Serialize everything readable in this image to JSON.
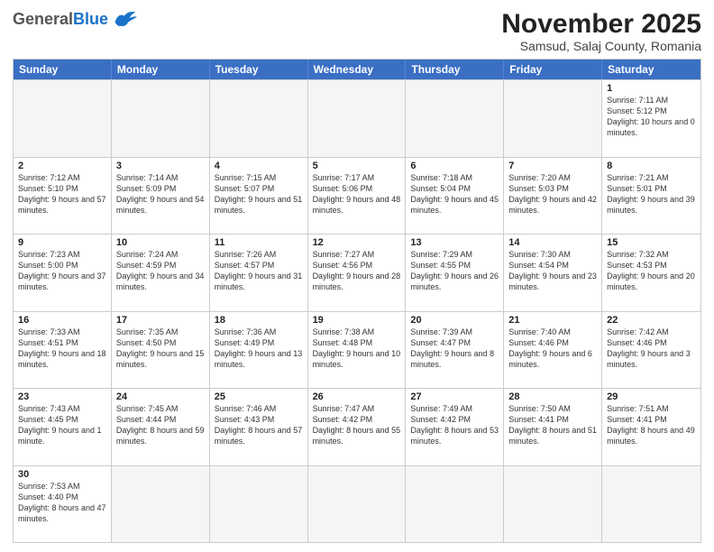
{
  "header": {
    "logo_general": "General",
    "logo_blue": "Blue",
    "month_title": "November 2025",
    "location": "Samsud, Salaj County, Romania"
  },
  "weekdays": [
    "Sunday",
    "Monday",
    "Tuesday",
    "Wednesday",
    "Thursday",
    "Friday",
    "Saturday"
  ],
  "rows": [
    [
      {
        "day": "",
        "text": "",
        "empty": true
      },
      {
        "day": "",
        "text": "",
        "empty": true
      },
      {
        "day": "",
        "text": "",
        "empty": true
      },
      {
        "day": "",
        "text": "",
        "empty": true
      },
      {
        "day": "",
        "text": "",
        "empty": true
      },
      {
        "day": "",
        "text": "",
        "empty": true
      },
      {
        "day": "1",
        "text": "Sunrise: 7:11 AM\nSunset: 5:12 PM\nDaylight: 10 hours and 0 minutes."
      }
    ],
    [
      {
        "day": "2",
        "text": "Sunrise: 7:12 AM\nSunset: 5:10 PM\nDaylight: 9 hours and 57 minutes."
      },
      {
        "day": "3",
        "text": "Sunrise: 7:14 AM\nSunset: 5:09 PM\nDaylight: 9 hours and 54 minutes."
      },
      {
        "day": "4",
        "text": "Sunrise: 7:15 AM\nSunset: 5:07 PM\nDaylight: 9 hours and 51 minutes."
      },
      {
        "day": "5",
        "text": "Sunrise: 7:17 AM\nSunset: 5:06 PM\nDaylight: 9 hours and 48 minutes."
      },
      {
        "day": "6",
        "text": "Sunrise: 7:18 AM\nSunset: 5:04 PM\nDaylight: 9 hours and 45 minutes."
      },
      {
        "day": "7",
        "text": "Sunrise: 7:20 AM\nSunset: 5:03 PM\nDaylight: 9 hours and 42 minutes."
      },
      {
        "day": "8",
        "text": "Sunrise: 7:21 AM\nSunset: 5:01 PM\nDaylight: 9 hours and 39 minutes."
      }
    ],
    [
      {
        "day": "9",
        "text": "Sunrise: 7:23 AM\nSunset: 5:00 PM\nDaylight: 9 hours and 37 minutes."
      },
      {
        "day": "10",
        "text": "Sunrise: 7:24 AM\nSunset: 4:59 PM\nDaylight: 9 hours and 34 minutes."
      },
      {
        "day": "11",
        "text": "Sunrise: 7:26 AM\nSunset: 4:57 PM\nDaylight: 9 hours and 31 minutes."
      },
      {
        "day": "12",
        "text": "Sunrise: 7:27 AM\nSunset: 4:56 PM\nDaylight: 9 hours and 28 minutes."
      },
      {
        "day": "13",
        "text": "Sunrise: 7:29 AM\nSunset: 4:55 PM\nDaylight: 9 hours and 26 minutes."
      },
      {
        "day": "14",
        "text": "Sunrise: 7:30 AM\nSunset: 4:54 PM\nDaylight: 9 hours and 23 minutes."
      },
      {
        "day": "15",
        "text": "Sunrise: 7:32 AM\nSunset: 4:53 PM\nDaylight: 9 hours and 20 minutes."
      }
    ],
    [
      {
        "day": "16",
        "text": "Sunrise: 7:33 AM\nSunset: 4:51 PM\nDaylight: 9 hours and 18 minutes."
      },
      {
        "day": "17",
        "text": "Sunrise: 7:35 AM\nSunset: 4:50 PM\nDaylight: 9 hours and 15 minutes."
      },
      {
        "day": "18",
        "text": "Sunrise: 7:36 AM\nSunset: 4:49 PM\nDaylight: 9 hours and 13 minutes."
      },
      {
        "day": "19",
        "text": "Sunrise: 7:38 AM\nSunset: 4:48 PM\nDaylight: 9 hours and 10 minutes."
      },
      {
        "day": "20",
        "text": "Sunrise: 7:39 AM\nSunset: 4:47 PM\nDaylight: 9 hours and 8 minutes."
      },
      {
        "day": "21",
        "text": "Sunrise: 7:40 AM\nSunset: 4:46 PM\nDaylight: 9 hours and 6 minutes."
      },
      {
        "day": "22",
        "text": "Sunrise: 7:42 AM\nSunset: 4:46 PM\nDaylight: 9 hours and 3 minutes."
      }
    ],
    [
      {
        "day": "23",
        "text": "Sunrise: 7:43 AM\nSunset: 4:45 PM\nDaylight: 9 hours and 1 minute."
      },
      {
        "day": "24",
        "text": "Sunrise: 7:45 AM\nSunset: 4:44 PM\nDaylight: 8 hours and 59 minutes."
      },
      {
        "day": "25",
        "text": "Sunrise: 7:46 AM\nSunset: 4:43 PM\nDaylight: 8 hours and 57 minutes."
      },
      {
        "day": "26",
        "text": "Sunrise: 7:47 AM\nSunset: 4:42 PM\nDaylight: 8 hours and 55 minutes."
      },
      {
        "day": "27",
        "text": "Sunrise: 7:49 AM\nSunset: 4:42 PM\nDaylight: 8 hours and 53 minutes."
      },
      {
        "day": "28",
        "text": "Sunrise: 7:50 AM\nSunset: 4:41 PM\nDaylight: 8 hours and 51 minutes."
      },
      {
        "day": "29",
        "text": "Sunrise: 7:51 AM\nSunset: 4:41 PM\nDaylight: 8 hours and 49 minutes."
      }
    ],
    [
      {
        "day": "30",
        "text": "Sunrise: 7:53 AM\nSunset: 4:40 PM\nDaylight: 8 hours and 47 minutes."
      },
      {
        "day": "",
        "text": "",
        "empty": true
      },
      {
        "day": "",
        "text": "",
        "empty": true
      },
      {
        "day": "",
        "text": "",
        "empty": true
      },
      {
        "day": "",
        "text": "",
        "empty": true
      },
      {
        "day": "",
        "text": "",
        "empty": true
      },
      {
        "day": "",
        "text": "",
        "empty": true
      }
    ]
  ]
}
